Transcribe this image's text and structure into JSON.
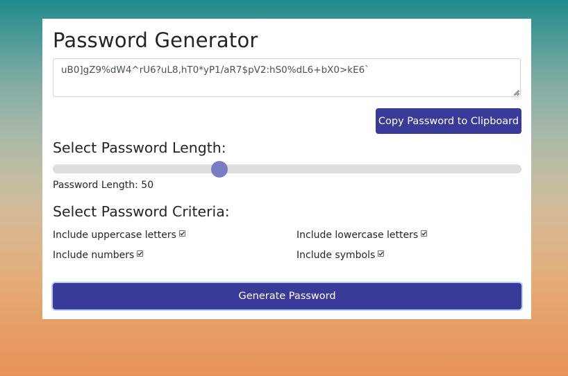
{
  "app": {
    "title": "Password Generator"
  },
  "password": {
    "value": "uB0]gZ9%dW4^rU6?uL8,hT0*yP1/aR7$pV2:hS0%dL6+bX0>kE6`"
  },
  "copy_button": {
    "label": "Copy Password to Clipboard"
  },
  "length_section": {
    "heading": "Select Password Length:",
    "label": "Password Length: 50",
    "value": 50,
    "min": 8,
    "max": 128
  },
  "criteria_section": {
    "heading": "Select Password Criteria:",
    "items": [
      {
        "label": "Include uppercase letters",
        "checked": true
      },
      {
        "label": "Include lowercase letters",
        "checked": true
      },
      {
        "label": "Include numbers",
        "checked": true
      },
      {
        "label": "Include symbols",
        "checked": true
      }
    ]
  },
  "generate_button": {
    "label": "Generate Password"
  },
  "colors": {
    "primary_button": "#3a3b98",
    "slider_thumb": "#7b7dc4",
    "slider_track": "#dedede"
  }
}
